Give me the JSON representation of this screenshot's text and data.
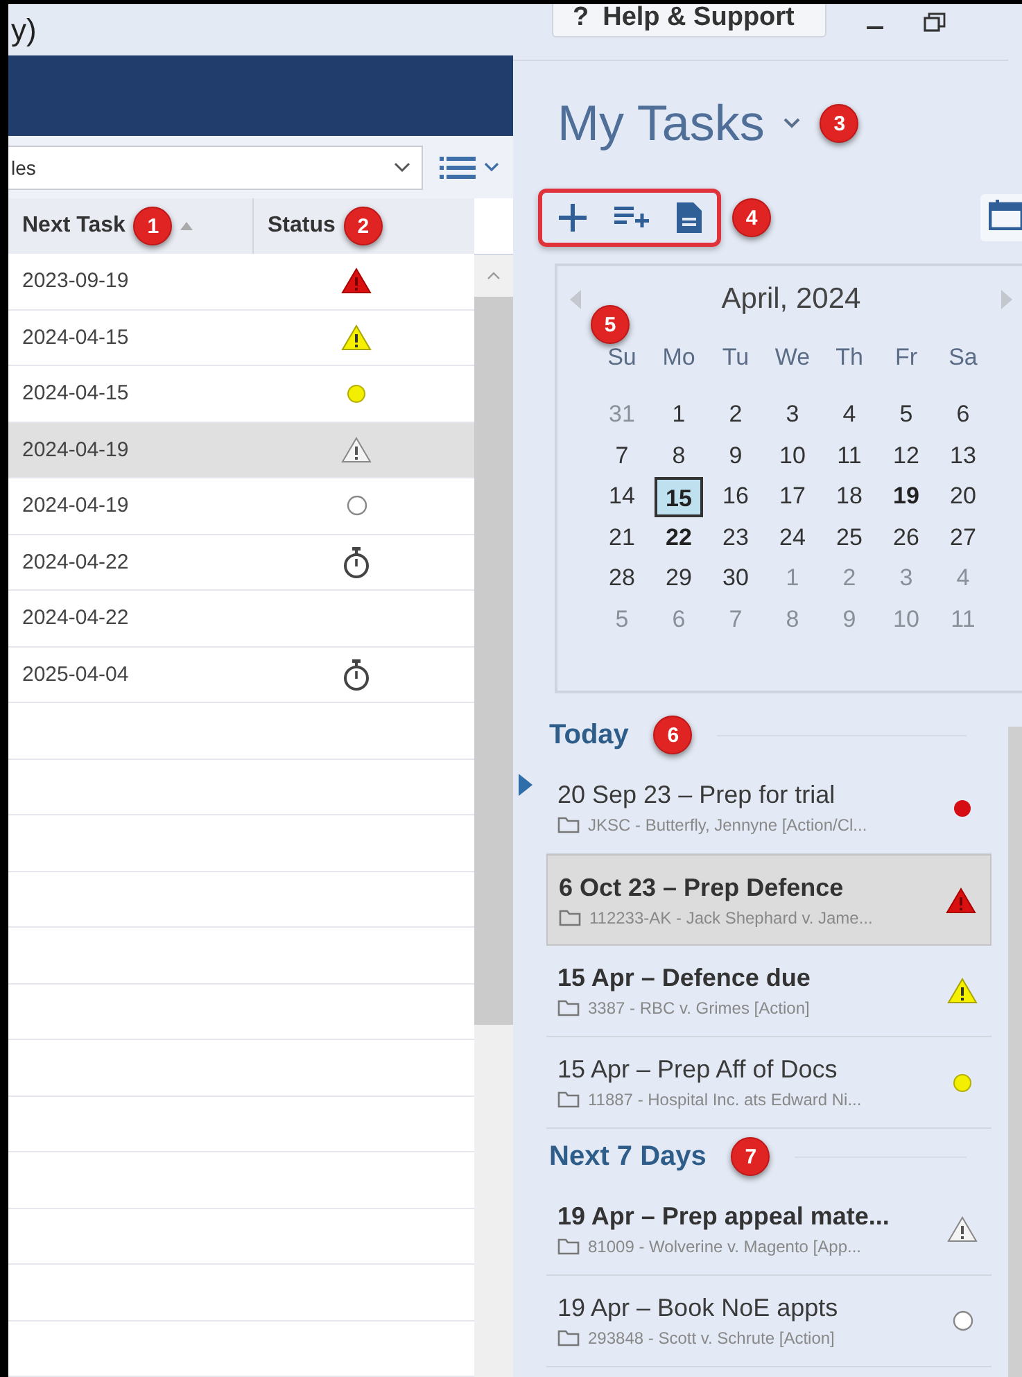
{
  "window": {
    "title": "y)"
  },
  "filter": {
    "value": "les"
  },
  "table": {
    "columns": [
      {
        "label": "Next Task",
        "badge": "1",
        "sorted": true
      },
      {
        "label": "Status",
        "badge": "2",
        "sorted": false
      }
    ],
    "rows": [
      {
        "next_task": "2023-09-19",
        "kind": "overdue",
        "selected": false
      },
      {
        "next_task": "2024-04-15",
        "kind": "warning",
        "selected": false
      },
      {
        "next_task": "2024-04-15",
        "kind": "due",
        "selected": false
      },
      {
        "next_task": "2024-04-19",
        "kind": "alert",
        "selected": true
      },
      {
        "next_task": "2024-04-19",
        "kind": "pending",
        "selected": false
      },
      {
        "next_task": "2024-04-22",
        "kind": "timer",
        "selected": false
      },
      {
        "next_task": "2024-04-22",
        "kind": "plain",
        "selected": false
      },
      {
        "next_task": "2025-04-04",
        "kind": "timer",
        "selected": false
      }
    ]
  },
  "help_button": {
    "icon": "?",
    "label": "Help & Support"
  },
  "panel": {
    "title": "My Tasks",
    "badge": "3"
  },
  "toolbar": {
    "badge": "4"
  },
  "calendar": {
    "month": "April, 2024",
    "badge": "5",
    "weekdays": [
      "Su",
      "Mo",
      "Tu",
      "We",
      "Th",
      "Fr",
      "Sa"
    ],
    "weeks": [
      [
        {
          "d": "31",
          "outside": true,
          "selected": false,
          "bold": false
        },
        {
          "d": "1",
          "outside": false,
          "selected": false,
          "bold": false
        },
        {
          "d": "2",
          "outside": false,
          "selected": false,
          "bold": false
        },
        {
          "d": "3",
          "outside": false,
          "selected": false,
          "bold": false
        },
        {
          "d": "4",
          "outside": false,
          "selected": false,
          "bold": false
        },
        {
          "d": "5",
          "outside": false,
          "selected": false,
          "bold": false
        },
        {
          "d": "6",
          "outside": false,
          "selected": false,
          "bold": false
        }
      ],
      [
        {
          "d": "7",
          "outside": false,
          "selected": false,
          "bold": false
        },
        {
          "d": "8",
          "outside": false,
          "selected": false,
          "bold": false
        },
        {
          "d": "9",
          "outside": false,
          "selected": false,
          "bold": false
        },
        {
          "d": "10",
          "outside": false,
          "selected": false,
          "bold": false
        },
        {
          "d": "11",
          "outside": false,
          "selected": false,
          "bold": false
        },
        {
          "d": "12",
          "outside": false,
          "selected": false,
          "bold": false
        },
        {
          "d": "13",
          "outside": false,
          "selected": false,
          "bold": false
        }
      ],
      [
        {
          "d": "14",
          "outside": false,
          "selected": false,
          "bold": false
        },
        {
          "d": "15",
          "outside": false,
          "selected": true,
          "bold": true
        },
        {
          "d": "16",
          "outside": false,
          "selected": false,
          "bold": false
        },
        {
          "d": "17",
          "outside": false,
          "selected": false,
          "bold": false
        },
        {
          "d": "18",
          "outside": false,
          "selected": false,
          "bold": false
        },
        {
          "d": "19",
          "outside": false,
          "selected": false,
          "bold": true
        },
        {
          "d": "20",
          "outside": false,
          "selected": false,
          "bold": false
        }
      ],
      [
        {
          "d": "21",
          "outside": false,
          "selected": false,
          "bold": false
        },
        {
          "d": "22",
          "outside": false,
          "selected": false,
          "bold": true
        },
        {
          "d": "23",
          "outside": false,
          "selected": false,
          "bold": false
        },
        {
          "d": "24",
          "outside": false,
          "selected": false,
          "bold": false
        },
        {
          "d": "25",
          "outside": false,
          "selected": false,
          "bold": false
        },
        {
          "d": "26",
          "outside": false,
          "selected": false,
          "bold": false
        },
        {
          "d": "27",
          "outside": false,
          "selected": false,
          "bold": false
        }
      ],
      [
        {
          "d": "28",
          "outside": false,
          "selected": false,
          "bold": false
        },
        {
          "d": "29",
          "outside": false,
          "selected": false,
          "bold": false
        },
        {
          "d": "30",
          "outside": false,
          "selected": false,
          "bold": false
        },
        {
          "d": "1",
          "outside": true,
          "selected": false,
          "bold": false
        },
        {
          "d": "2",
          "outside": true,
          "selected": false,
          "bold": false
        },
        {
          "d": "3",
          "outside": true,
          "selected": false,
          "bold": false
        },
        {
          "d": "4",
          "outside": true,
          "selected": false,
          "bold": false
        }
      ],
      [
        {
          "d": "5",
          "outside": true,
          "selected": false,
          "bold": false
        },
        {
          "d": "6",
          "outside": true,
          "selected": false,
          "bold": false
        },
        {
          "d": "7",
          "outside": true,
          "selected": false,
          "bold": false
        },
        {
          "d": "8",
          "outside": true,
          "selected": false,
          "bold": false
        },
        {
          "d": "9",
          "outside": true,
          "selected": false,
          "bold": false
        },
        {
          "d": "10",
          "outside": true,
          "selected": false,
          "bold": false
        },
        {
          "d": "11",
          "outside": true,
          "selected": false,
          "bold": false
        }
      ]
    ]
  },
  "task_groups": [
    {
      "heading": "Today",
      "badge": "6",
      "tasks": [
        {
          "title": "20 Sep 23 – Prep for trial",
          "matter": "JKSC - Butterfly, Jennyne [Action/Cl...",
          "kind": "urgent",
          "bold": false,
          "selected": false
        },
        {
          "title": "6 Oct 23 – Prep Defence",
          "matter": "112233-AK - Jack Shephard v. Jame...",
          "kind": "overdue",
          "bold": true,
          "selected": true
        },
        {
          "title": "15 Apr – Defence due",
          "matter": "3387 - RBC v. Grimes [Action]",
          "kind": "warning",
          "bold": true,
          "selected": false
        },
        {
          "title": "15 Apr – Prep Aff of Docs",
          "matter": "11887 - Hospital Inc. ats Edward Ni...",
          "kind": "due",
          "bold": false,
          "selected": false
        }
      ]
    },
    {
      "heading": "Next 7 Days",
      "badge": "7",
      "tasks": [
        {
          "title": "19 Apr – Prep appeal mate...",
          "matter": "81009 - Wolverine v. Magento [App...",
          "kind": "alert",
          "bold": true,
          "selected": false
        },
        {
          "title": "19 Apr – Book NoE appts",
          "matter": "293848 - Scott v. Schrute [Action]",
          "kind": "pending",
          "bold": false,
          "selected": false
        }
      ]
    }
  ]
}
